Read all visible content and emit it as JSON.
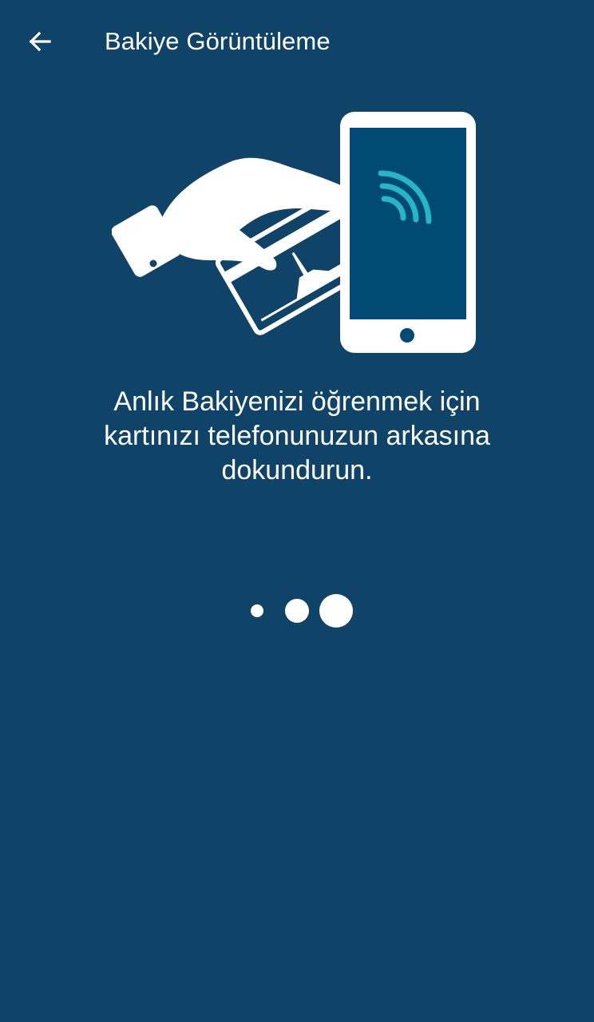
{
  "app_bar": {
    "back_icon": "arrow-left-icon",
    "title": "Bakiye Görüntüleme"
  },
  "illustration": {
    "icon": "hand-card-phone-nfc-icon",
    "nfc_color": "#27b6c8",
    "phone_screen_color": "#004a73"
  },
  "main": {
    "instruction": "Anlık Bakiyenizi öğrenmek için kartınızı telefonunuzun arkasına dokundurun."
  },
  "loader": {
    "icon": "loading-dots-icon",
    "dots": 3
  },
  "colors": {
    "background": "#0f4468",
    "foreground": "#ffffff",
    "accent": "#27b6c8"
  }
}
